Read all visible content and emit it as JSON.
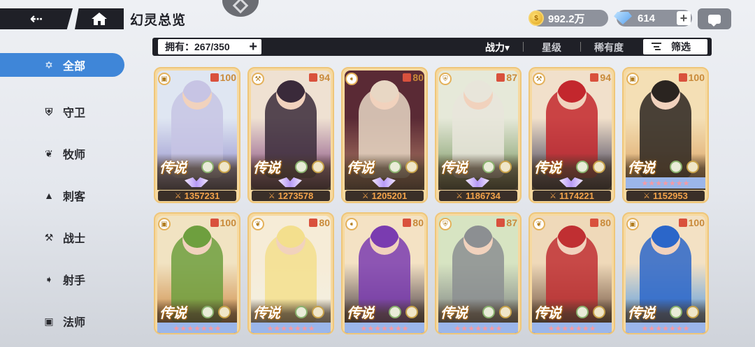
{
  "header": {
    "title": "幻灵总览",
    "back_icon": "back-arrow-icon",
    "home_icon": "home-icon",
    "gold": "992.2万",
    "gems": "614",
    "gem_plus": "+",
    "chat_icon": "chat-icon"
  },
  "sidebar": {
    "items": [
      {
        "label": "全部",
        "icon": "star-icon",
        "active": true
      },
      {
        "label": "守卫",
        "icon": "shield-icon"
      },
      {
        "label": "牧师",
        "icon": "wings-icon"
      },
      {
        "label": "刺客",
        "icon": "claw-icon"
      },
      {
        "label": "战士",
        "icon": "axe-icon"
      },
      {
        "label": "射手",
        "icon": "bow-icon"
      },
      {
        "label": "法师",
        "icon": "book-icon"
      }
    ]
  },
  "filterbar": {
    "owned_label": "拥有：267/350",
    "owned_plus": "+",
    "sort_power": "战力▾",
    "sort_star": "星级",
    "sort_rarity": "稀有度",
    "filter_label": "筛选"
  },
  "cards": [
    {
      "rarity": "传说",
      "level": "100",
      "power": "1357231",
      "role": "book-icon",
      "colors": [
        "#dfe6f2",
        "#c7c4e4",
        "#8c87c8"
      ]
    },
    {
      "rarity": "传说",
      "level": "94",
      "power": "1273578",
      "role": "axe-icon",
      "colors": [
        "#efe1d2",
        "#3a2a3a",
        "#7a3b78"
      ]
    },
    {
      "rarity": "传说",
      "level": "80",
      "power": "1205201",
      "role": "bow-icon",
      "colors": [
        "#5a2a35",
        "#e8d7c4",
        "#b9836a"
      ]
    },
    {
      "rarity": "传说",
      "level": "87",
      "power": "1186734",
      "role": "shield-icon",
      "colors": [
        "#e6e9d9",
        "#e8e5da",
        "#6f8f56"
      ]
    },
    {
      "rarity": "传说",
      "level": "94",
      "power": "1174221",
      "role": "axe-icon",
      "colors": [
        "#f1e0cb",
        "#c3272d",
        "#2e2c4a"
      ]
    },
    {
      "rarity": "传说",
      "level": "100",
      "power": "1152953",
      "role": "book-icon",
      "colors": [
        "#f4dfb5",
        "#2a2420",
        "#d89c5a"
      ]
    },
    {
      "rarity": "传说",
      "level": "100",
      "power": "",
      "role": "book-icon",
      "colors": [
        "#f1e3c2",
        "#6e9f3e",
        "#c77a2e"
      ]
    },
    {
      "rarity": "传说",
      "level": "80",
      "power": "",
      "role": "wings-icon",
      "colors": [
        "#f6ecd7",
        "#f3df8d",
        "#f2f0e4"
      ]
    },
    {
      "rarity": "传说",
      "level": "80",
      "power": "",
      "role": "bow-icon",
      "colors": [
        "#f4e2c4",
        "#7a3cb0",
        "#2a1f2e"
      ]
    },
    {
      "rarity": "传说",
      "level": "87",
      "power": "",
      "role": "shield-icon",
      "colors": [
        "#d7e4c2",
        "#8c8f92",
        "#6c7075"
      ]
    },
    {
      "rarity": "传说",
      "level": "80",
      "power": "",
      "role": "wings-icon",
      "colors": [
        "#efd9b9",
        "#c02f32",
        "#5a3a2a"
      ]
    },
    {
      "rarity": "传说",
      "level": "100",
      "power": "",
      "role": "book-icon",
      "colors": [
        "#f3e1c4",
        "#2b66c9",
        "#3b8ee6"
      ]
    }
  ]
}
